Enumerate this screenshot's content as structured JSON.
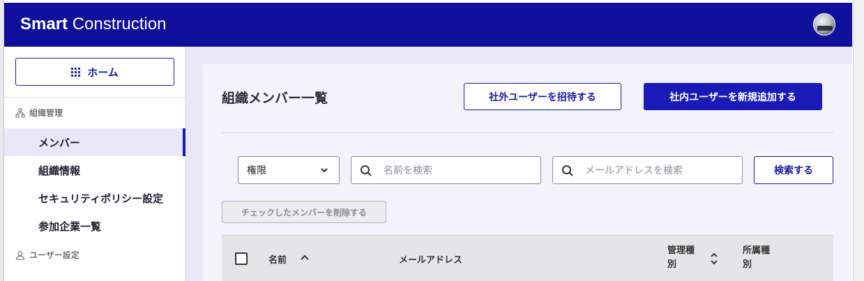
{
  "header": {
    "brand_bold": "Smart",
    "brand_light": "Construction"
  },
  "sidebar": {
    "home_label": "ホーム",
    "section_org": "組織管理",
    "items": [
      {
        "label": "メンバー",
        "active": true
      },
      {
        "label": "組織情報",
        "active": false
      },
      {
        "label": "セキュリティポリシー設定",
        "active": false
      },
      {
        "label": "参加企業一覧",
        "active": false
      }
    ],
    "section_user": "ユーザー設定"
  },
  "main": {
    "title": "組織メンバー一覧",
    "invite_external_label": "社外ユーザーを招待する",
    "add_internal_label": "社内ユーザーを新規追加する",
    "filter": {
      "role_select_value": "権限",
      "name_search_placeholder": "名前を検索",
      "email_search_placeholder": "メールアドレスを検索",
      "search_button_label": "検索する"
    },
    "delete_checked_label": "チェックしたメンバーを削除する",
    "table": {
      "columns": {
        "name": "名前",
        "email": "メールアドレス",
        "admin_type": "管理種別",
        "affiliation_type": "所属種別"
      }
    }
  },
  "colors": {
    "brand": "#11109c",
    "accent": "#1a1ab8",
    "content_bg": "#e8e8f8"
  }
}
